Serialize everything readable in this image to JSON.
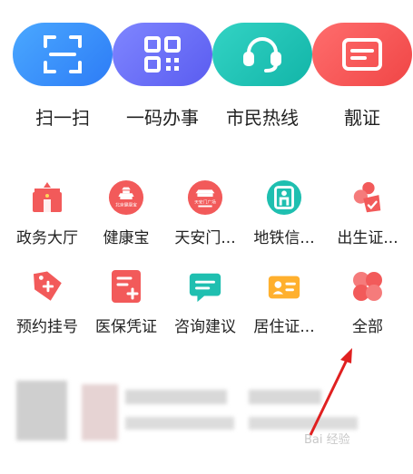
{
  "top_actions": [
    {
      "label": "扫一扫",
      "icon": "scan-icon",
      "color_from": "#4aa8ff",
      "color_to": "#2d7cf6"
    },
    {
      "label": "一码办事",
      "icon": "qr-code-icon",
      "color_from": "#7f86ff",
      "color_to": "#5a5cf0"
    },
    {
      "label": "市民热线",
      "icon": "headset-icon",
      "color_from": "#33d3c4",
      "color_to": "#12b5a8"
    },
    {
      "label": "靓证",
      "icon": "card-icon",
      "color_from": "#ff6d6d",
      "color_to": "#f04646"
    }
  ],
  "services": [
    {
      "label": "政务大厅",
      "icon": "government-hall-icon"
    },
    {
      "label": "健康宝",
      "icon": "health-treasure-icon",
      "icon_text": "北京健康宝"
    },
    {
      "label": "天安门...",
      "icon": "tiananmen-icon",
      "icon_text": "天安门广场"
    },
    {
      "label": "地铁信...",
      "icon": "metro-icon"
    },
    {
      "label": "出生证...",
      "icon": "birth-certificate-icon"
    },
    {
      "label": "预约挂号",
      "icon": "appointment-tag-icon"
    },
    {
      "label": "医保凭证",
      "icon": "medical-insurance-icon"
    },
    {
      "label": "咨询建议",
      "icon": "consultation-chat-icon"
    },
    {
      "label": "居住证...",
      "icon": "residence-permit-icon"
    },
    {
      "label": "全部",
      "icon": "all-services-icon"
    }
  ],
  "colors": {
    "red": "#f25a5a",
    "teal": "#1fbfb0",
    "orange": "#ffb02e",
    "arrow": "#e02020"
  },
  "watermark": {
    "text": "Bai 经验"
  }
}
